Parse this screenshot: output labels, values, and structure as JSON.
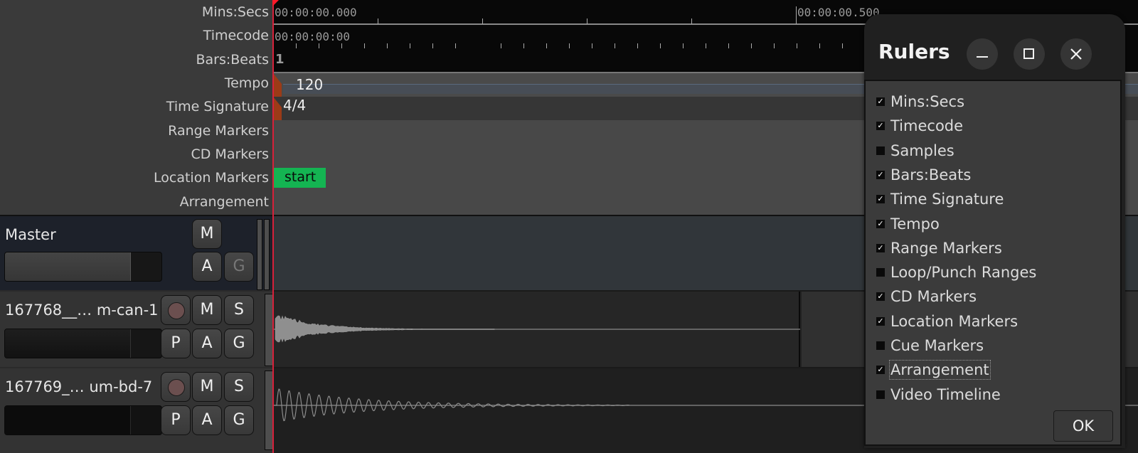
{
  "rulers": {
    "labels": [
      "Mins:Secs",
      "Timecode",
      "Bars:Beats",
      "Tempo",
      "Time Signature",
      "Range Markers",
      "CD Markers",
      "Location Markers",
      "Arrangement"
    ],
    "mins_secs": [
      "00:00:00.000",
      "00:00:00.500"
    ],
    "timecode": "00:00:00:00",
    "bars_beats": "1",
    "tempo": "120",
    "time_signature": "4/4",
    "location_marker": "start"
  },
  "tracks": [
    {
      "name": "Master",
      "buttons": [
        "M",
        "A",
        "G"
      ],
      "fader_level": 0.8
    },
    {
      "name": "167768__… m-can-1",
      "buttons": [
        "M",
        "S",
        "P",
        "A",
        "G"
      ],
      "fader_level": 0.8
    },
    {
      "name": "167769_… um-bd-7",
      "buttons": [
        "M",
        "S",
        "P",
        "A",
        "G"
      ],
      "fader_level": 0.8
    }
  ],
  "dialog": {
    "title": "Rulers",
    "items": [
      {
        "label": "Mins:Secs",
        "checked": true
      },
      {
        "label": "Timecode",
        "checked": true
      },
      {
        "label": "Samples",
        "checked": false
      },
      {
        "label": "Bars:Beats",
        "checked": true
      },
      {
        "label": "Time Signature",
        "checked": true
      },
      {
        "label": "Tempo",
        "checked": true
      },
      {
        "label": "Range Markers",
        "checked": true
      },
      {
        "label": "Loop/Punch Ranges",
        "checked": false
      },
      {
        "label": "CD Markers",
        "checked": true
      },
      {
        "label": "Location Markers",
        "checked": true
      },
      {
        "label": "Cue Markers",
        "checked": false
      },
      {
        "label": "Arrangement",
        "checked": true
      },
      {
        "label": "Video Timeline",
        "checked": false
      }
    ],
    "ok_label": "OK",
    "check_glyph": "✓"
  },
  "colors": {
    "playhead": "#d7213a",
    "location_marker": "#14b452",
    "tempo_marker": "#9b3b17"
  }
}
